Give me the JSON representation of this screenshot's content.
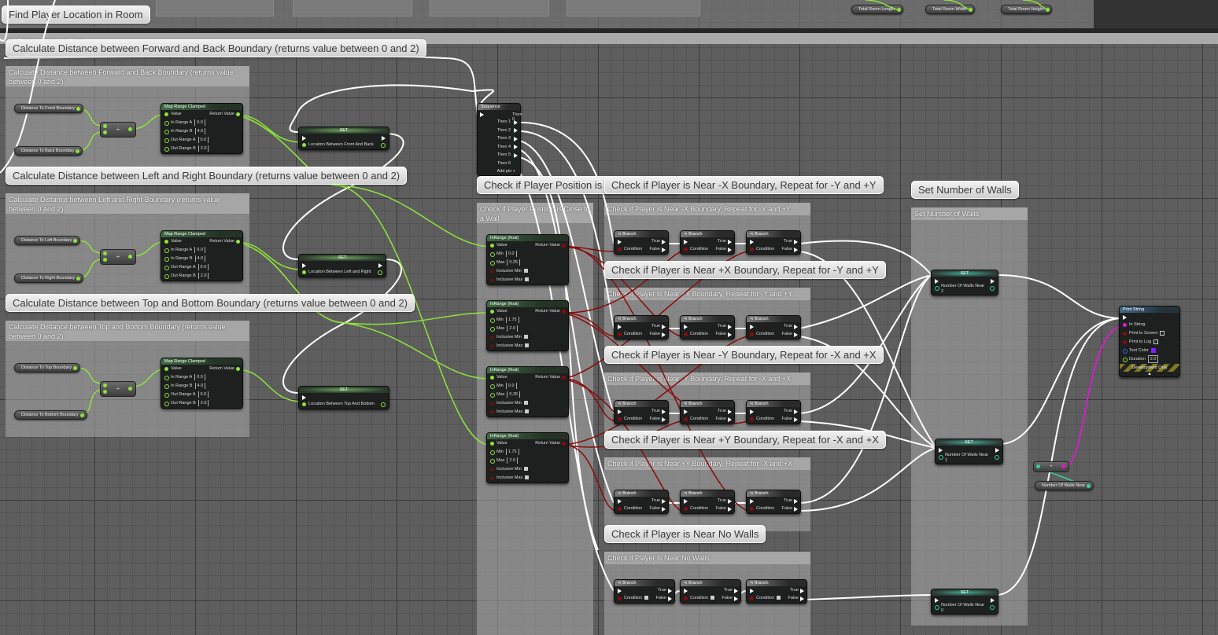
{
  "graph_title": "Find Player Location in Room",
  "top_variables": [
    "Total Room Length",
    "Total Room Width",
    "Total Room Height"
  ],
  "outer_comment_label": "Find Player Location in Room",
  "sections": {
    "fb": {
      "bubble": "Calculate Distance between Forward and Back Boundary (returns value between 0 and 2)",
      "header": "Calculate Distance between Forward and Back Boundary (returns value between 0 and 2)",
      "var_a": "Distance To Front Boundary",
      "var_b": "Distance To Back Boundary",
      "set_var": "Location Between Front And Back"
    },
    "lr": {
      "bubble": "Calculate Distance between Left and Right Boundary (returns value between 0 and 2)",
      "header": "Calculate Distance between Left and Right Boundary (returns value between 0 and 2)",
      "var_a": "Distance To Left Boundary",
      "var_b": "Distance To Right Boundary",
      "set_var": "Location Between Left and Right"
    },
    "tb": {
      "bubble": "Calculate Distance between Top and Bottom Boundary (returns value between 0 and 2)",
      "header": "Calculate Distance between Top and Bottom Boundary (returns value between 0 and 2)",
      "var_a": "Distance To Top Boundary",
      "var_b": "Distance To Bottom Boundary",
      "set_var": "Location Between Top And Bottom"
    }
  },
  "divide_symbol": "÷",
  "map_range": {
    "title": "Map Range Clamped",
    "value": "Value",
    "return": "Return Value",
    "in_a": "In Range A",
    "in_a_val": "0.0",
    "in_b": "In Range B",
    "in_b_val": "4.0",
    "out_a": "Out Range A",
    "out_a_val": "0.0",
    "out_b": "Out Range B",
    "out_b_val": "2.0"
  },
  "set_title": "SET",
  "sequence": {
    "title": "Sequence",
    "outputs": [
      "Then 0",
      "Then 1",
      "Then 2",
      "Then 3",
      "Then 4",
      "Then 5",
      "Then 6"
    ],
    "add_pin": "Add pin"
  },
  "wall_check": {
    "bubble": "Check if Player Position is Close to a Wall",
    "header": "Check if Player Position is Close to a Wall",
    "inrange_title": "InRange (float)",
    "labels": {
      "value": "Value",
      "return": "Return Value",
      "min": "Min",
      "max": "Max",
      "inc_min": "Inclusive Min",
      "inc_max": "Inclusive Max"
    },
    "nodes": [
      {
        "min": "0.0",
        "max": "0.25"
      },
      {
        "min": "1.75",
        "max": "2.0"
      },
      {
        "min": "0.0",
        "max": "0.25"
      },
      {
        "min": "1.75",
        "max": "2.0"
      }
    ]
  },
  "branch_groups": [
    {
      "bubble": "Check if Player is Near -X Boundary, Repeat for -Y and +Y",
      "header": "Check if Player is Near -X Boundary, Repeat for -Y and +Y"
    },
    {
      "bubble": "Check if Player is Near +X Boundary, Repeat for -Y and +Y",
      "header": "Check if Player is Near +X Boundary, Repeat for -Y and +Y"
    },
    {
      "bubble": "Check if Player is Near -Y Boundary, Repeat for -X and +X",
      "header": "Check if Player is Near -Y Boundary, Repeat for -X and +X"
    },
    {
      "bubble": "Check if Player is Near +Y Boundary, Repeat for -X and +X",
      "header": "Check if Player is Near +Y Boundary, Repeat for -X and +X"
    },
    {
      "bubble": "Check if Player is Near No Walls",
      "header": "Check if Player is Near No Walls"
    }
  ],
  "branch": {
    "title": "Branch",
    "true": "True",
    "false": "False",
    "condition": "Condition"
  },
  "set_walls": {
    "bubble": "Set Number of Walls",
    "header": "Set Number of Walls",
    "var": "Number Of Walls Near",
    "values": [
      "2",
      "1",
      "0"
    ]
  },
  "conv_symbol": "•",
  "get_walls_var": "Number Of Walls Near",
  "print_string": {
    "title": "Print String",
    "in_string": "In String",
    "print_screen": "Print to Screen",
    "print_log": "Print to Log",
    "text_color": "Text Color",
    "text_color_hex": "#7a1fff",
    "duration": "Duration",
    "duration_val": "2.0",
    "dev_only": "Development Only"
  },
  "colors": {
    "float_pin": "#8ee33a",
    "bool_pin": "#8a0b0b",
    "int_pin": "#2fd3a1",
    "string_pin": "#e019d3",
    "exec_wire": "#ffffff"
  }
}
